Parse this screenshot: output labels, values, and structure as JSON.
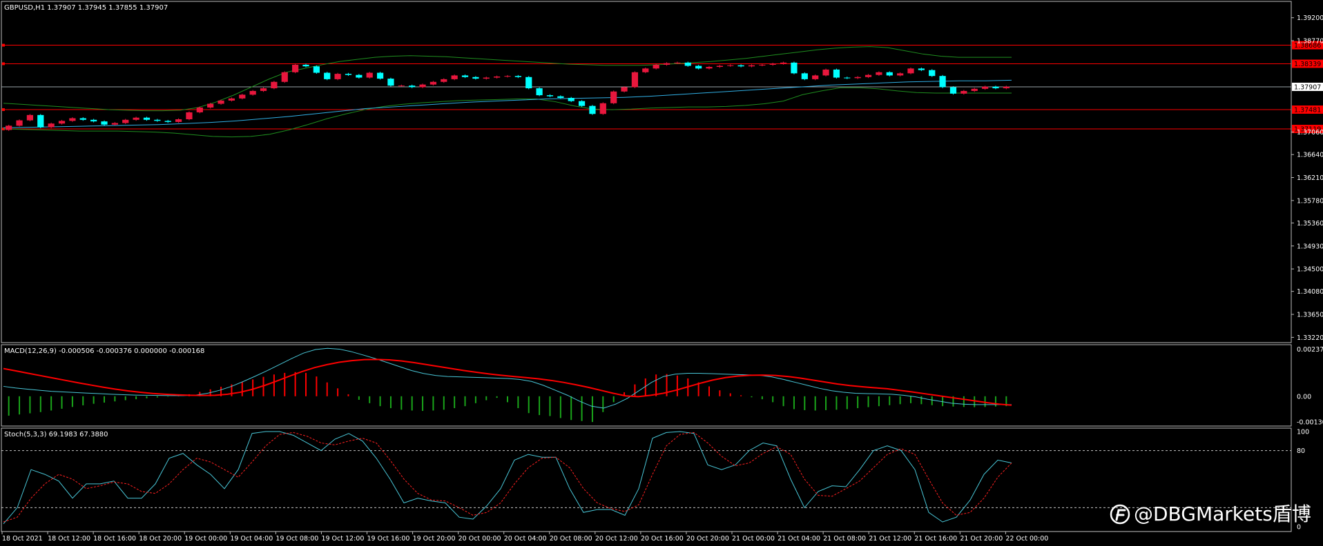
{
  "colors": {
    "background": "#000000",
    "frame": "#c0c0c0",
    "bull": "#e8173d",
    "bear": "#00ffff",
    "bollinger": "#1f8f1f",
    "ma": "#31b0e6",
    "level_line": "#ff0000",
    "macd_hist_pos": "#ff0000",
    "macd_hist_neg": "#1aa51a",
    "macd_signal": "#ff0000",
    "macd_line": "#49c7d8",
    "stoch_main": "#49c7d8",
    "stoch_signal": "#ff2020",
    "stoch_level": "#c8c8c8",
    "watermark": "#ffffff"
  },
  "watermark": {
    "icon": "weibo-icon",
    "text": "@DBGMarkets盾博"
  },
  "chart_data": [
    {
      "type": "candlestick",
      "title": "GBPUSD,H1  1.37907 1.37945 1.37855 1.37907",
      "ylim": [
        1.3316,
        1.3948
      ],
      "y_ticks": [
        "1.39200",
        "1.38770",
        "1.37060",
        "1.36640",
        "1.36210",
        "1.35780",
        "1.35360",
        "1.34930",
        "1.34500",
        "1.34080",
        "1.33650",
        "1.33220"
      ],
      "y_tick_values": [
        1.392,
        1.3877,
        1.3706,
        1.3664,
        1.3621,
        1.3578,
        1.3536,
        1.3493,
        1.345,
        1.3408,
        1.3365,
        1.3322
      ],
      "x_labels": [
        "18 Oct 2021",
        "18 Oct 12:00",
        "18 Oct 16:00",
        "18 Oct 20:00",
        "19 Oct 00:00",
        "19 Oct 04:00",
        "19 Oct 08:00",
        "19 Oct 12:00",
        "19 Oct 16:00",
        "19 Oct 20:00",
        "20 Oct 00:00",
        "20 Oct 04:00",
        "20 Oct 08:00",
        "20 Oct 12:00",
        "20 Oct 16:00",
        "20 Oct 20:00",
        "21 Oct 00:00",
        "21 Oct 04:00",
        "21 Oct 08:00",
        "21 Oct 12:00",
        "21 Oct 16:00",
        "21 Oct 20:00",
        "22 Oct 00:00"
      ],
      "levels": [
        {
          "value": 1.38686,
          "label": "1.38686"
        },
        {
          "value": 1.38339,
          "label": "1.38339"
        },
        {
          "value": 1.37907,
          "label": "1.37907",
          "current": true
        },
        {
          "value": 1.37481,
          "label": "1.37481"
        },
        {
          "value": 1.37119,
          "label": "1.37119"
        }
      ],
      "candles": {
        "close": [
          1.3718,
          1.3728,
          1.3738,
          1.3715,
          1.3722,
          1.3727,
          1.3732,
          1.3729,
          1.3726,
          1.372,
          1.3723,
          1.3729,
          1.3733,
          1.3729,
          1.3727,
          1.3725,
          1.373,
          1.3743,
          1.3752,
          1.3759,
          1.3765,
          1.3769,
          1.3776,
          1.3783,
          1.3788,
          1.38,
          1.3818,
          1.3832,
          1.3829,
          1.3817,
          1.3805,
          1.3815,
          1.3813,
          1.3808,
          1.3817,
          1.3806,
          1.3793,
          1.3793,
          1.379,
          1.3795,
          1.38,
          1.3805,
          1.3812,
          1.3809,
          1.3806,
          1.3808,
          1.381,
          1.3811,
          1.3809,
          1.3788,
          1.3775,
          1.3773,
          1.377,
          1.3764,
          1.3755,
          1.374,
          1.376,
          1.3782,
          1.379,
          1.3818,
          1.3825,
          1.3832,
          1.3835,
          1.3836,
          1.383,
          1.3825,
          1.3828,
          1.383,
          1.3831,
          1.3829,
          1.3831,
          1.3832,
          1.3834,
          1.3836,
          1.3816,
          1.3805,
          1.3812,
          1.3823,
          1.3808,
          1.3807,
          1.3809,
          1.3813,
          1.3818,
          1.3812,
          1.3816,
          1.3825,
          1.3822,
          1.3811,
          1.379,
          1.3778,
          1.3783,
          1.3787,
          1.3791,
          1.3788,
          1.3791
        ],
        "open": [
          1.371,
          1.3718,
          1.3728,
          1.3738,
          1.3715,
          1.3722,
          1.3727,
          1.3732,
          1.3729,
          1.3726,
          1.372,
          1.3723,
          1.3729,
          1.3733,
          1.3729,
          1.3727,
          1.3725,
          1.373,
          1.3743,
          1.3752,
          1.3759,
          1.3765,
          1.3769,
          1.3776,
          1.3783,
          1.3788,
          1.38,
          1.3818,
          1.3832,
          1.3829,
          1.3817,
          1.3805,
          1.3815,
          1.3813,
          1.3808,
          1.3817,
          1.3806,
          1.3793,
          1.3793,
          1.379,
          1.3795,
          1.38,
          1.3805,
          1.3812,
          1.3809,
          1.3806,
          1.3808,
          1.381,
          1.3811,
          1.3809,
          1.3788,
          1.3775,
          1.3773,
          1.377,
          1.3764,
          1.3755,
          1.374,
          1.376,
          1.3782,
          1.379,
          1.3818,
          1.3825,
          1.3832,
          1.3835,
          1.3836,
          1.383,
          1.3825,
          1.3828,
          1.383,
          1.3831,
          1.3829,
          1.3831,
          1.3832,
          1.3834,
          1.3836,
          1.3816,
          1.3805,
          1.3812,
          1.3823,
          1.3808,
          1.3807,
          1.3809,
          1.3813,
          1.3818,
          1.3812,
          1.3816,
          1.3825,
          1.3822,
          1.3811,
          1.379,
          1.3778,
          1.3783,
          1.3787,
          1.3791,
          1.3788
        ]
      },
      "bollinger_upper": [
        1.376,
        1.3758,
        1.3756,
        1.3754,
        1.3752,
        1.375,
        1.3748,
        1.3747,
        1.3746,
        1.3746,
        1.3747,
        1.3752,
        1.3762,
        1.3775,
        1.379,
        1.3805,
        1.3818,
        1.3825,
        1.3832,
        1.3838,
        1.3842,
        1.3846,
        1.3848,
        1.3849,
        1.3848,
        1.3847,
        1.3845,
        1.3843,
        1.3841,
        1.3839,
        1.3837,
        1.3835,
        1.3833,
        1.3832,
        1.3831,
        1.3831,
        1.3831,
        1.3832,
        1.3834,
        1.3836,
        1.3838,
        1.3841,
        1.3844,
        1.3848,
        1.3852,
        1.3856,
        1.386,
        1.3863,
        1.3865,
        1.3866,
        1.3864,
        1.3858,
        1.3852,
        1.3848,
        1.3846,
        1.3846,
        1.3846,
        1.3846
      ],
      "bollinger_upper_x": [
        0.0,
        0.02,
        0.04,
        0.06,
        0.08,
        0.1,
        0.12,
        0.14,
        0.16,
        0.18,
        0.2,
        0.22,
        0.24,
        0.26,
        0.28,
        0.3,
        0.32,
        0.34,
        0.36,
        0.38,
        0.4,
        0.42,
        0.44,
        0.46,
        0.48,
        0.5,
        0.52,
        0.54,
        0.56,
        0.58,
        0.6,
        0.62,
        0.64,
        0.66,
        0.68,
        0.7,
        0.72,
        0.74,
        0.76,
        0.78,
        0.8,
        0.82,
        0.84,
        0.86,
        0.88,
        0.9,
        0.92,
        0.94,
        0.96,
        0.98,
        1.0,
        1.02,
        1.04,
        1.06,
        1.08,
        1.1,
        1.12,
        1.14
      ],
      "bollinger_lower": [
        1.3712,
        1.3711,
        1.371,
        1.3709,
        1.3708,
        1.3708,
        1.3708,
        1.3707,
        1.3706,
        1.3704,
        1.3701,
        1.3698,
        1.3697,
        1.3698,
        1.3702,
        1.371,
        1.372,
        1.3731,
        1.374,
        1.3748,
        1.3754,
        1.3758,
        1.3761,
        1.3763,
        1.3765,
        1.3766,
        1.3767,
        1.3768,
        1.3768,
        1.3763,
        1.3755,
        1.3749,
        1.3748,
        1.3749,
        1.3751,
        1.3752,
        1.3753,
        1.3753,
        1.3754,
        1.3756,
        1.3759,
        1.3764,
        1.3776,
        1.3783,
        1.3789,
        1.3789,
        1.3787,
        1.3783,
        1.378,
        1.3779,
        1.3779,
        1.3779,
        1.3779,
        1.3779
      ],
      "ma": [
        1.3714,
        1.3715,
        1.3716,
        1.3717,
        1.3718,
        1.3719,
        1.372,
        1.3722,
        1.3724,
        1.3727,
        1.3731,
        1.3735,
        1.374,
        1.3745,
        1.375,
        1.3753,
        1.3756,
        1.3759,
        1.3762,
        1.3764,
        1.3766,
        1.3768,
        1.3769,
        1.377,
        1.3771,
        1.3773,
        1.3776,
        1.3779,
        1.3782,
        1.3785,
        1.3788,
        1.3791,
        1.3794,
        1.3796,
        1.3798,
        1.38,
        1.3801,
        1.3802,
        1.3802,
        1.3803
      ]
    },
    {
      "type": "macd",
      "title": "MACD(12,26,9) -0.000506 -0.000376 0.000000 -0.000168",
      "y_ticks": [
        "0.002377",
        "0.00",
        "-0.001303"
      ],
      "y_tick_values": [
        0.002377,
        0.0,
        -0.001303
      ],
      "ylim": [
        -0.0014,
        0.0025
      ],
      "histogram": [
        -0.00098,
        -0.00092,
        -0.00086,
        -0.0008,
        -0.00072,
        -0.00063,
        -0.00054,
        -0.00046,
        -0.00038,
        -0.00032,
        -0.00026,
        -0.0002,
        -0.00015,
        -0.0001,
        -6e-05,
        -2e-05,
        2e-05,
        0.0001,
        0.00022,
        0.00035,
        0.00048,
        0.0006,
        0.00072,
        0.00085,
        0.00098,
        0.0011,
        0.00118,
        0.00122,
        0.00118,
        0.001,
        0.0007,
        0.0004,
        0.0001,
        -0.00018,
        -0.00035,
        -0.0005,
        -0.0006,
        -0.00068,
        -0.00072,
        -0.00074,
        -0.00072,
        -0.00068,
        -0.0006,
        -0.0005,
        -0.00035,
        -0.0002,
        -8e-05,
        -0.0003,
        -0.0006,
        -0.00085,
        -0.00095,
        -0.001,
        -0.0011,
        -0.0012,
        -0.00125,
        -0.0013,
        -0.0008,
        -0.0003,
        0.0002,
        0.0006,
        0.0009,
        0.0011,
        0.00112,
        0.00105,
        0.0009,
        0.0007,
        0.0005,
        0.0003,
        0.00015,
        5e-05,
        -5e-05,
        -0.00015,
        -0.0003,
        -0.0005,
        -0.00065,
        -0.0007,
        -0.00072,
        -0.0007,
        -0.00068,
        -0.00065,
        -0.0006,
        -0.00055,
        -0.0005,
        -0.00045,
        -0.0004,
        -0.00035,
        -0.0004,
        -0.00045,
        -0.0005,
        -0.00052,
        -0.00054,
        -0.00055,
        -0.00054,
        -0.00052,
        -0.0005
      ],
      "signal": [
        0.0014,
        0.00128,
        0.00116,
        0.00104,
        0.00092,
        0.0008,
        0.00068,
        0.00057,
        0.00046,
        0.00036,
        0.00027,
        0.0002,
        0.00014,
        0.0001,
        7e-05,
        5e-05,
        4e-05,
        5e-05,
        0.0001,
        0.0002,
        0.00035,
        0.00055,
        0.00078,
        0.00102,
        0.00125,
        0.00145,
        0.0016,
        0.00172,
        0.0018,
        0.00185,
        0.00186,
        0.00184,
        0.00178,
        0.0017,
        0.0016,
        0.0015,
        0.0014,
        0.0013,
        0.00121,
        0.00113,
        0.00106,
        0.001,
        0.00094,
        0.00088,
        0.0008,
        0.0007,
        0.00058,
        0.00045,
        0.0003,
        0.00015,
        2e-05,
        -2e-05,
        5e-05,
        0.00015,
        0.0003,
        0.00048,
        0.00066,
        0.00082,
        0.00094,
        0.00102,
        0.00106,
        0.00107,
        0.00105,
        0.001,
        0.00092,
        0.00082,
        0.00072,
        0.00062,
        0.00054,
        0.00048,
        0.00043,
        0.00038,
        0.0003,
        0.00022,
        0.00013,
        4e-05,
        -5e-05,
        -0.00014,
        -0.00023,
        -0.00032,
        -0.0004,
        -0.00045
      ],
      "main": [
        0.0005,
        0.00042,
        0.00036,
        0.0003,
        0.00025,
        0.00022,
        0.00019,
        0.00016,
        0.00013,
        0.0001,
        8e-05,
        6e-05,
        5e-05,
        4e-05,
        3e-05,
        3e-05,
        6e-05,
        0.00015,
        0.0003,
        0.0005,
        0.00075,
        0.00102,
        0.0013,
        0.0016,
        0.0019,
        0.00218,
        0.00236,
        0.00242,
        0.00238,
        0.00225,
        0.00208,
        0.0019,
        0.0017,
        0.0015,
        0.0013,
        0.00115,
        0.00105,
        0.001,
        0.00098,
        0.00096,
        0.00094,
        0.00092,
        0.0009,
        0.00085,
        0.00075,
        0.00055,
        0.0003,
        5e-05,
        -0.00025,
        -0.0005,
        -0.0006,
        -0.0004,
        -0.0001,
        0.0003,
        0.0007,
        0.001,
        0.00112,
        0.00116,
        0.00116,
        0.00114,
        0.00112,
        0.0011,
        0.00108,
        0.00106,
        0.00098,
        0.00085,
        0.0007,
        0.00055,
        0.0004,
        0.00028,
        0.0002,
        0.00015,
        0.00013,
        0.00012,
        0.0001,
        5e-05,
        -3e-05,
        -0.00015,
        -0.00025,
        -0.00035,
        -0.0004,
        -0.00042,
        -0.00042,
        -0.00042,
        -0.00042
      ]
    },
    {
      "type": "stochastic",
      "title": "Stoch(5,3,3) 69.1983 67.3880",
      "y_ticks": [
        "100",
        "80",
        "0"
      ],
      "y_tick_values": [
        100,
        80,
        0
      ],
      "levels": [
        80,
        20
      ],
      "ylim": [
        0,
        100
      ],
      "main": [
        3,
        20,
        60,
        55,
        48,
        30,
        45,
        45,
        48,
        30,
        30,
        45,
        72,
        77,
        65,
        55,
        40,
        60,
        98,
        100,
        100,
        96,
        88,
        80,
        92,
        98,
        90,
        72,
        50,
        25,
        30,
        27,
        25,
        10,
        8,
        22,
        40,
        70,
        76,
        73,
        73,
        40,
        15,
        18,
        18,
        12,
        40,
        93,
        99,
        100,
        98,
        65,
        60,
        65,
        80,
        88,
        85,
        50,
        20,
        37,
        43,
        42,
        60,
        80,
        85,
        80,
        60,
        15,
        5,
        10,
        28,
        55,
        70,
        67
      ],
      "signal": [
        5,
        10,
        30,
        45,
        55,
        50,
        40,
        43,
        47,
        45,
        37,
        35,
        45,
        60,
        72,
        68,
        60,
        52,
        68,
        85,
        97,
        99,
        95,
        88,
        86,
        90,
        93,
        88,
        70,
        50,
        35,
        28,
        27,
        20,
        12,
        15,
        25,
        45,
        62,
        72,
        73,
        62,
        40,
        25,
        19,
        16,
        23,
        55,
        85,
        97,
        99,
        88,
        74,
        64,
        67,
        77,
        84,
        76,
        50,
        33,
        32,
        40,
        48,
        62,
        76,
        82,
        76,
        50,
        25,
        12,
        15,
        30,
        52,
        67
      ]
    }
  ]
}
